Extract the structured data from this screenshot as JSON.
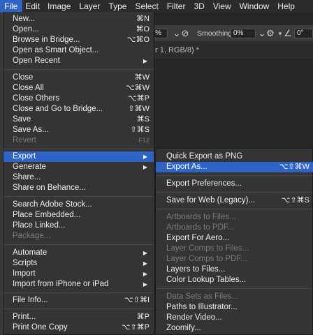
{
  "menubar": {
    "items": [
      "File",
      "Edit",
      "Image",
      "Layer",
      "Type",
      "Select",
      "Filter",
      "3D",
      "View",
      "Window",
      "Help"
    ]
  },
  "options_bar": {
    "zoom_value": "%",
    "smoothing_label": "Smoothing:",
    "smoothing_value": "0%",
    "angle_value": "0°"
  },
  "document": {
    "tab_title": "r 1, RGB/8) *"
  },
  "file_menu": {
    "new": {
      "label": "New...",
      "shortcut": "⌘N"
    },
    "open": {
      "label": "Open...",
      "shortcut": "⌘O"
    },
    "browse_bridge": {
      "label": "Browse in Bridge...",
      "shortcut": "⌥⌘O"
    },
    "open_smart": {
      "label": "Open as Smart Object..."
    },
    "open_recent": {
      "label": "Open Recent"
    },
    "close": {
      "label": "Close",
      "shortcut": "⌘W"
    },
    "close_all": {
      "label": "Close All",
      "shortcut": "⌥⌘W"
    },
    "close_others": {
      "label": "Close Others",
      "shortcut": "⌥⌘P"
    },
    "close_bridge": {
      "label": "Close and Go to Bridge...",
      "shortcut": "⇧⌘W"
    },
    "save": {
      "label": "Save",
      "shortcut": "⌘S"
    },
    "save_as": {
      "label": "Save As...",
      "shortcut": "⇧⌘S"
    },
    "revert": {
      "label": "Revert",
      "shortcut": "F12"
    },
    "export": {
      "label": "Export"
    },
    "generate": {
      "label": "Generate"
    },
    "share": {
      "label": "Share..."
    },
    "share_behance": {
      "label": "Share on Behance..."
    },
    "search_stock": {
      "label": "Search Adobe Stock..."
    },
    "place_embedded": {
      "label": "Place Embedded..."
    },
    "place_linked": {
      "label": "Place Linked..."
    },
    "package": {
      "label": "Package..."
    },
    "automate": {
      "label": "Automate"
    },
    "scripts": {
      "label": "Scripts"
    },
    "import": {
      "label": "Import"
    },
    "import_iphone": {
      "label": "Import from iPhone or iPad"
    },
    "file_info": {
      "label": "File Info...",
      "shortcut": "⌥⇧⌘I"
    },
    "print": {
      "label": "Print...",
      "shortcut": "⌘P"
    },
    "print_one": {
      "label": "Print One Copy",
      "shortcut": "⌥⇧⌘P"
    }
  },
  "export_menu": {
    "quick_export": {
      "label": "Quick Export as PNG"
    },
    "export_as": {
      "label": "Export As...",
      "shortcut": "⌥⇧⌘W"
    },
    "export_prefs": {
      "label": "Export Preferences..."
    },
    "save_web": {
      "label": "Save for Web (Legacy)...",
      "shortcut": "⌥⇧⌘S"
    },
    "artboards_files": {
      "label": "Artboards to Files..."
    },
    "artboards_pdf": {
      "label": "Artboards to PDF..."
    },
    "export_aero": {
      "label": "Export For Aero..."
    },
    "layer_comps_files": {
      "label": "Layer Comps to Files..."
    },
    "layer_comps_pdf": {
      "label": "Layer Comps to PDF..."
    },
    "layers_files": {
      "label": "Layers to Files..."
    },
    "color_lookup": {
      "label": "Color Lookup Tables..."
    },
    "data_sets": {
      "label": "Data Sets as Files..."
    },
    "paths_illustrator": {
      "label": "Paths to Illustrator..."
    },
    "render_video": {
      "label": "Render Video..."
    },
    "zoomify": {
      "label": "Zoomify..."
    }
  },
  "colors": {
    "highlight": "#2f64c7",
    "menu_bg": "#343434",
    "disabled_text": "#7b7b7b"
  }
}
